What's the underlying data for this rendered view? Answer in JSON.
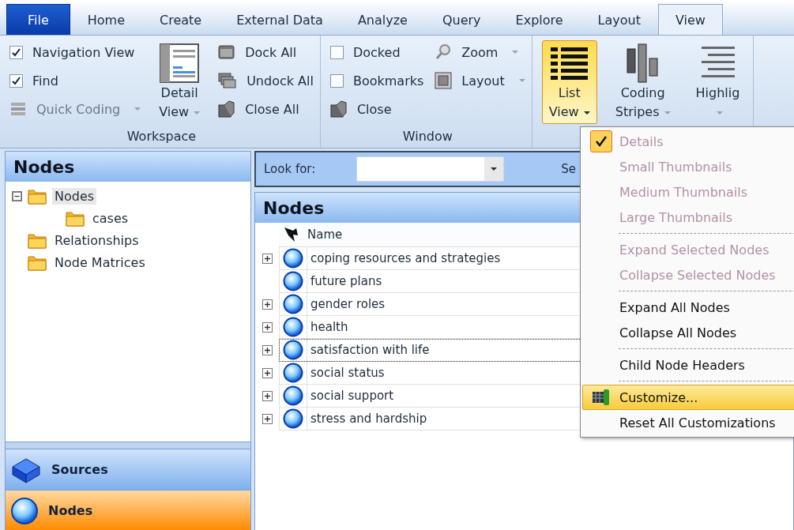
{
  "tabs": [
    {
      "label": "File",
      "kind": "file",
      "selected": false
    },
    {
      "label": "Home",
      "kind": "tab",
      "selected": false
    },
    {
      "label": "Create",
      "kind": "tab",
      "selected": false
    },
    {
      "label": "External Data",
      "kind": "tab",
      "selected": false
    },
    {
      "label": "Analyze",
      "kind": "tab",
      "selected": false
    },
    {
      "label": "Query",
      "kind": "tab",
      "selected": false
    },
    {
      "label": "Explore",
      "kind": "tab",
      "selected": false
    },
    {
      "label": "Layout",
      "kind": "tab",
      "selected": false
    },
    {
      "label": "View",
      "kind": "tab",
      "selected": true
    }
  ],
  "ribbon": {
    "groups": [
      {
        "label": "Workspace",
        "columns": [
          [
            {
              "kind": "check",
              "label": "Navigation View",
              "checked": true
            },
            {
              "kind": "check",
              "label": "Find",
              "checked": true
            },
            {
              "kind": "small",
              "label": "Quick Coding",
              "disabled": true,
              "dropdown": true
            }
          ],
          [
            {
              "kind": "large",
              "lines": [
                "Detail",
                "View"
              ],
              "dropdown": true,
              "selected": false
            }
          ],
          [
            {
              "kind": "small",
              "label": "Dock All",
              "disabled": false,
              "dropdown": false
            },
            {
              "kind": "small",
              "label": "Undock All",
              "disabled": false,
              "dropdown": false
            },
            {
              "kind": "small",
              "label": "Close All",
              "disabled": false,
              "dropdown": false
            }
          ]
        ]
      },
      {
        "label": "Window",
        "columns": [
          [
            {
              "kind": "check",
              "label": "Docked",
              "checked": false
            },
            {
              "kind": "check",
              "label": "Bookmarks",
              "checked": false
            },
            {
              "kind": "small",
              "label": "Close",
              "disabled": false,
              "dropdown": false
            }
          ],
          [
            {
              "kind": "small",
              "label": "Zoom",
              "disabled": false,
              "dropdown": true
            },
            {
              "kind": "small",
              "label": "Layout",
              "disabled": false,
              "dropdown": true
            }
          ]
        ]
      },
      {
        "columns": [
          [
            {
              "kind": "large",
              "lines": [
                "List",
                "View"
              ],
              "dropdown": true,
              "selected": true
            }
          ],
          [
            {
              "kind": "large",
              "lines": [
                "Coding",
                "Stripes"
              ],
              "dropdown": true,
              "selected": false
            }
          ],
          [
            {
              "kind": "large",
              "lines": [
                "Highlig"
              ],
              "dropdown": true,
              "selected": false
            }
          ]
        ]
      }
    ]
  },
  "navigation": {
    "title": "Nodes",
    "tree": [
      {
        "label": "Nodes",
        "selected": true,
        "expanded": true,
        "children": [
          {
            "label": "cases",
            "selected": false
          }
        ]
      },
      {
        "label": "Relationships",
        "selected": false
      },
      {
        "label": "Node Matrices",
        "selected": false
      }
    ],
    "sections": [
      {
        "label": "Sources",
        "selected": false
      },
      {
        "label": "Nodes",
        "selected": true
      }
    ]
  },
  "find_bar": {
    "label": "Look for:",
    "column_3": "Se"
  },
  "list": {
    "title": "Nodes",
    "columns": [
      "Name"
    ],
    "rows": [
      {
        "name": "coping resources and strategies",
        "expandable": true,
        "focused": false
      },
      {
        "name": "future plans",
        "expandable": false,
        "focused": false
      },
      {
        "name": "gender roles",
        "expandable": true,
        "focused": false
      },
      {
        "name": "health",
        "expandable": true,
        "focused": false
      },
      {
        "name": "satisfaction with life",
        "expandable": true,
        "focused": true
      },
      {
        "name": "social status",
        "expandable": true,
        "focused": false
      },
      {
        "name": "social support",
        "expandable": true,
        "focused": false
      },
      {
        "name": "stress and hardship",
        "expandable": true,
        "focused": false
      }
    ]
  },
  "menu": {
    "groups": [
      [
        {
          "label": "Details",
          "checked": true,
          "disabled": true,
          "selected": false
        },
        {
          "label": "Small Thumbnails",
          "checked": false,
          "disabled": true,
          "selected": false
        },
        {
          "label": "Medium Thumbnails",
          "checked": false,
          "disabled": true,
          "selected": false
        },
        {
          "label": "Large Thumbnails",
          "checked": false,
          "disabled": true,
          "selected": false
        }
      ],
      [
        {
          "label": "Expand Selected Nodes",
          "checked": false,
          "disabled": true,
          "selected": false
        },
        {
          "label": "Collapse Selected Nodes",
          "checked": false,
          "disabled": true,
          "selected": false
        }
      ],
      [
        {
          "label": "Expand All Nodes",
          "checked": false,
          "disabled": false,
          "selected": false
        },
        {
          "label": "Collapse All Nodes",
          "checked": false,
          "disabled": false,
          "selected": false
        }
      ],
      [
        {
          "label": "Child Node Headers",
          "checked": false,
          "disabled": false,
          "selected": false
        }
      ],
      [
        {
          "label": "Customize...",
          "checked": false,
          "disabled": false,
          "selected": true,
          "icon": true
        },
        {
          "label": "Reset All Customizations",
          "checked": false,
          "disabled": false,
          "selected": false
        }
      ]
    ]
  }
}
